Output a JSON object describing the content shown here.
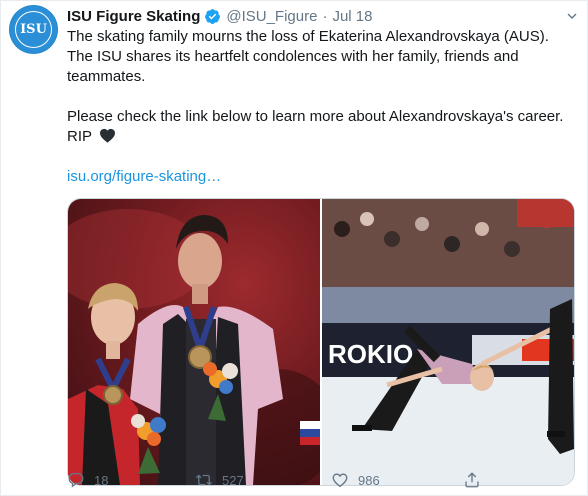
{
  "account": {
    "display_name": "ISU Figure Skating",
    "handle": "@ISU_Figure",
    "separator": "·",
    "date": "Jul 18",
    "avatar_text": "ISU"
  },
  "tweet": {
    "line1": "The skating family mourns the loss of Ekaterina Alexandrovskaya (AUS). The ISU shares its heartfelt condolences with her family, friends and teammates.",
    "line2": "Please check the link below to learn more about Alexandrovskaya's career.",
    "line3": "RIP",
    "link": "isu.org/figure-skating…"
  },
  "media": {
    "right_banner_text": "ROKIO"
  },
  "actions": {
    "replies": "18",
    "retweets": "527",
    "likes": "986"
  },
  "colors": {
    "link": "#1b95e0",
    "muted": "#657786",
    "verified": "#1da1f2"
  }
}
